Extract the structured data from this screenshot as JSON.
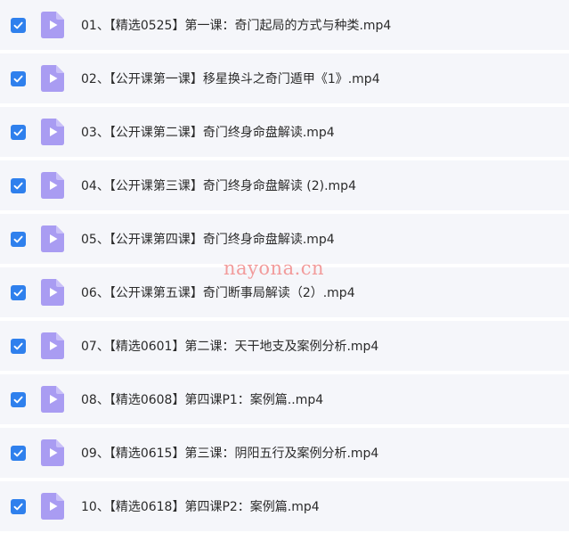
{
  "files": [
    {
      "name": "01、【精选0525】第一课：奇门起局的方式与种类.mp4",
      "checked": true,
      "icon": "video-file-icon"
    },
    {
      "name": "02、【公开课第一课】移星换斗之奇门遁甲《1》.mp4",
      "checked": true,
      "icon": "video-file-icon"
    },
    {
      "name": "03、【公开课第二课】奇门终身命盘解读.mp4",
      "checked": true,
      "icon": "video-file-icon"
    },
    {
      "name": "04、【公开课第三课】奇门终身命盘解读 (2).mp4",
      "checked": true,
      "icon": "video-file-icon"
    },
    {
      "name": "05、【公开课第四课】奇门终身命盘解读.mp4",
      "checked": true,
      "icon": "video-file-icon"
    },
    {
      "name": "06、【公开课第五课】奇门断事局解读（2）.mp4",
      "checked": true,
      "icon": "video-file-icon"
    },
    {
      "name": "07、【精选0601】第二课：天干地支及案例分析.mp4",
      "checked": true,
      "icon": "video-file-icon"
    },
    {
      "name": "08、【精选0608】第四课P1：案例篇..mp4",
      "checked": true,
      "icon": "video-file-icon"
    },
    {
      "name": "09、【精选0615】第三课：阴阳五行及案例分析.mp4",
      "checked": true,
      "icon": "video-file-icon"
    },
    {
      "name": "10、【精选0618】第四课P2：案例篇.mp4",
      "checked": true,
      "icon": "video-file-icon"
    }
  ],
  "watermark": "nayona.cn",
  "colors": {
    "checkbox": "#2f80ed",
    "row_background": "#f5f6fa",
    "icon_fill": "#a99cf2",
    "watermark": "#f29b9b"
  }
}
